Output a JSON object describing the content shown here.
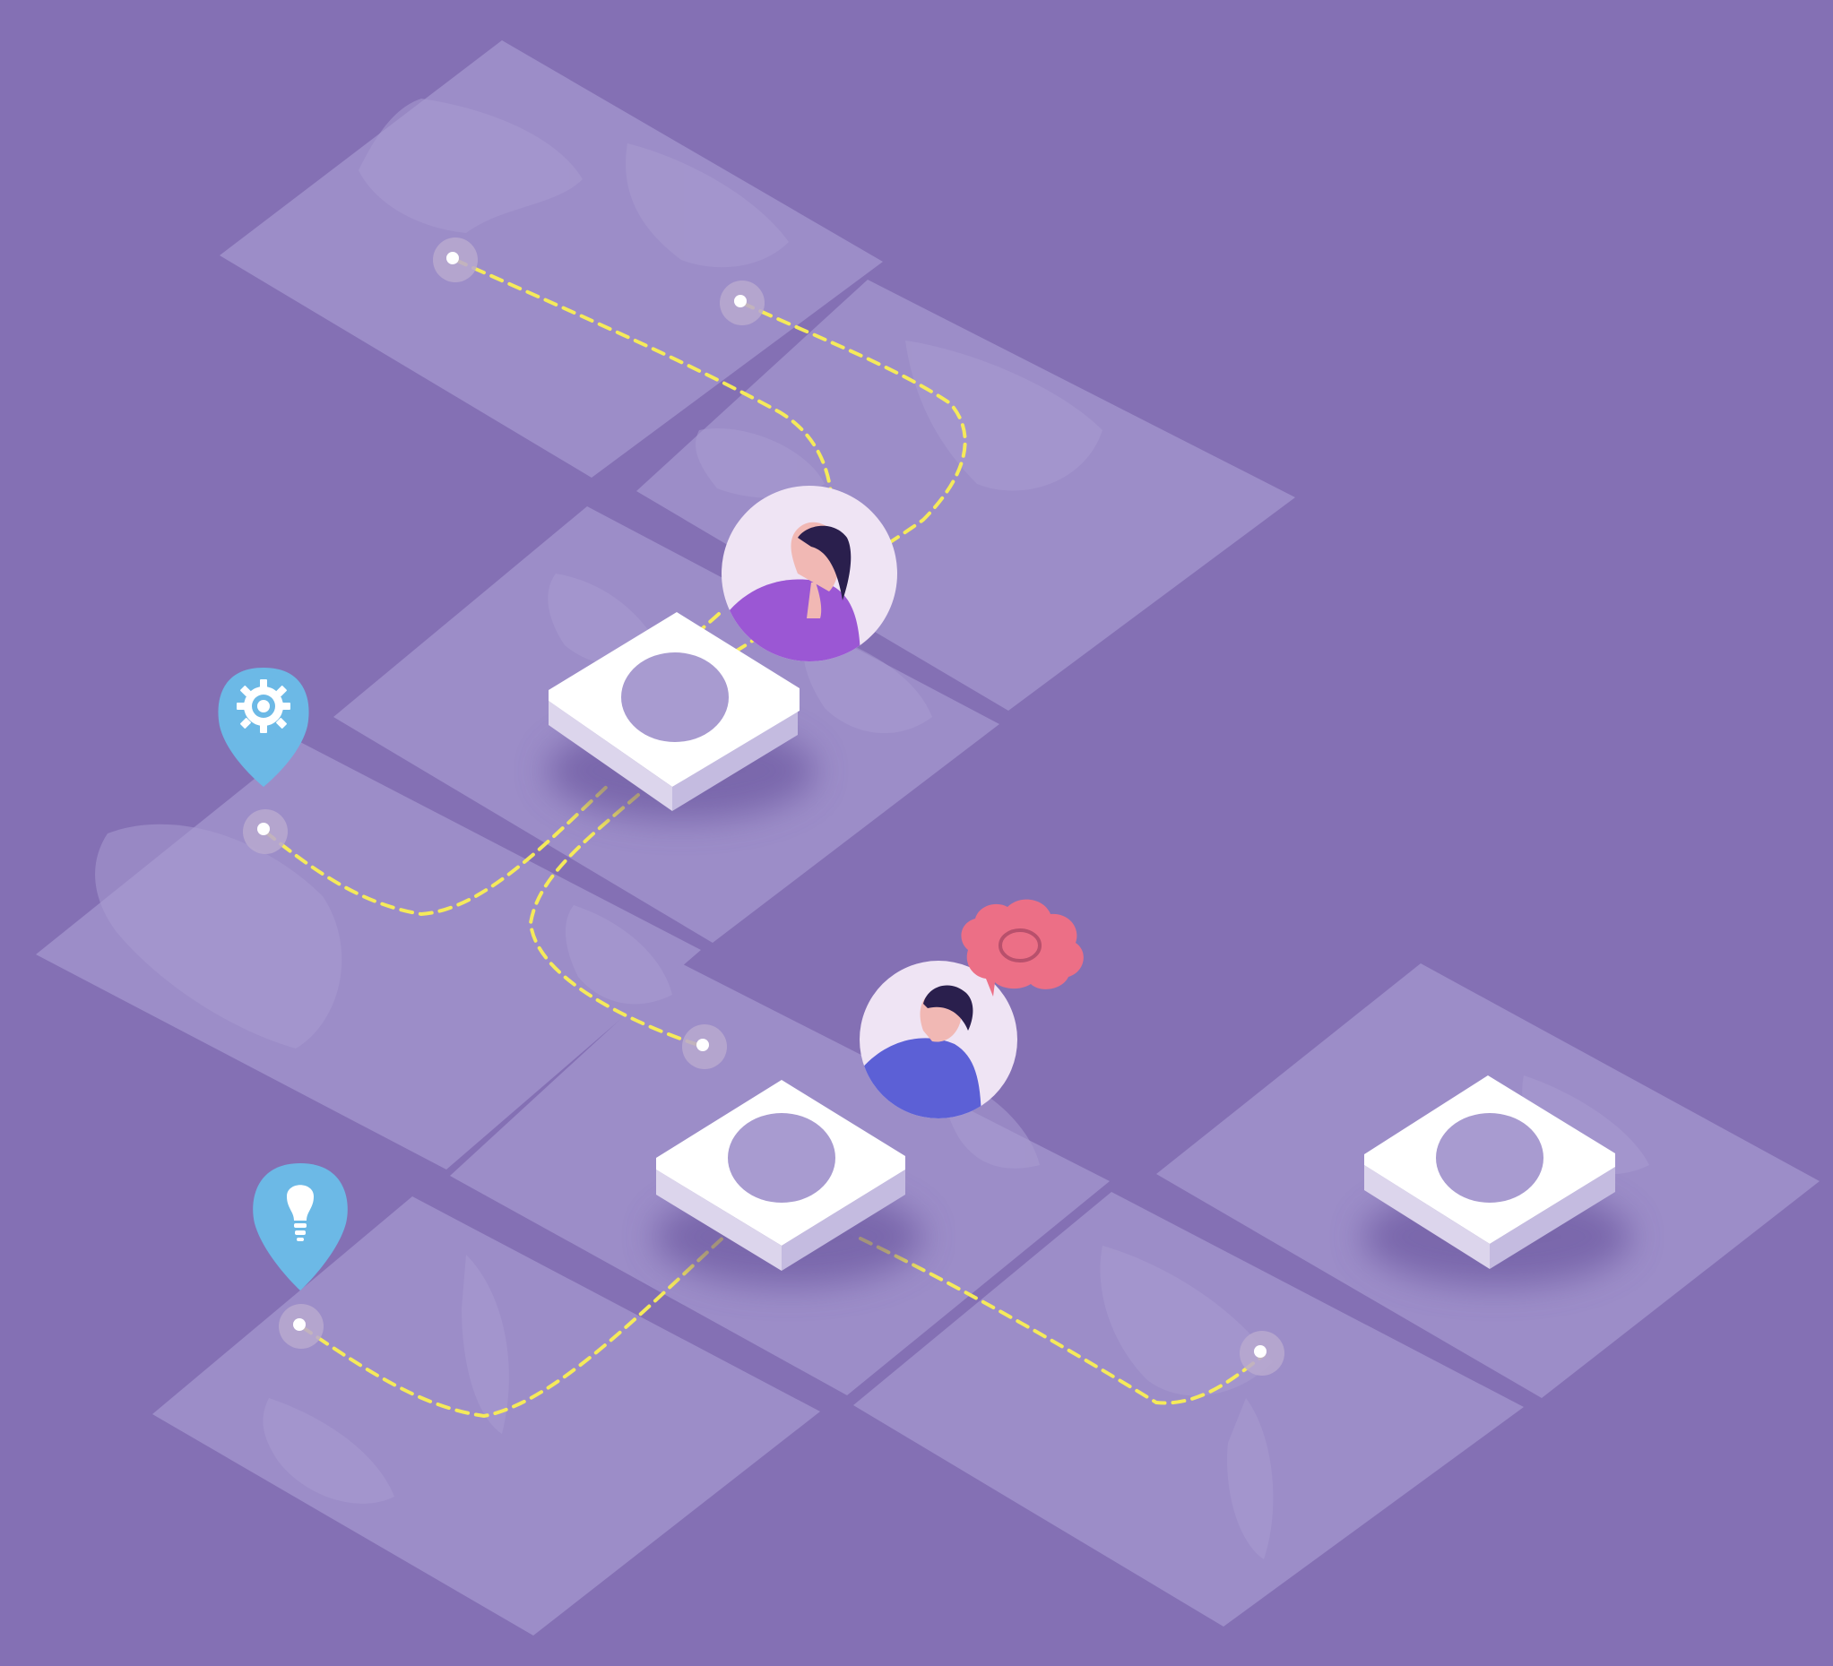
{
  "scene": {
    "background_color": "#8470b4",
    "tile_color": "#9c8dc8",
    "continent_color": "#a99cd1",
    "route_color": "#f5ea5a",
    "node_color": "#ffffff",
    "node_hole_color": "#a89bd0",
    "pin_color": "#6cb9e6",
    "bubble_color": "#ec6f86",
    "avatar_bg_color": "#efe4f4"
  },
  "icons": [
    "gear-map-pin-icon",
    "lightbulb-map-pin-icon",
    "cloud-speech-bubble-icon",
    "woman-avatar-icon",
    "man-avatar-icon"
  ]
}
